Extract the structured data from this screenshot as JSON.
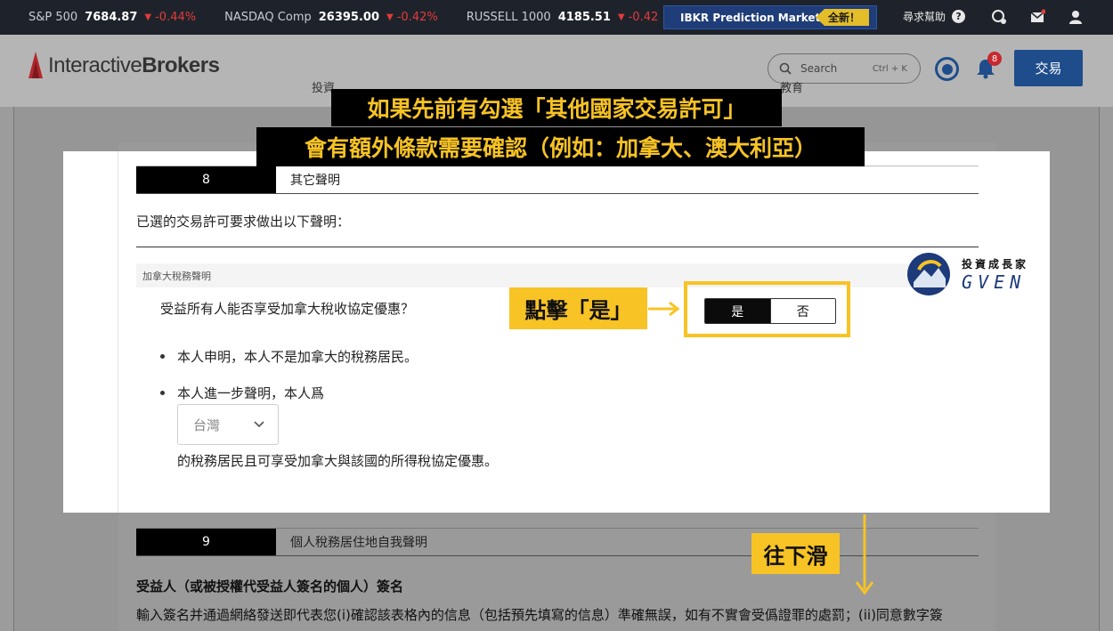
{
  "ticker": [
    {
      "name": "S&P 500",
      "value": "7684.87",
      "change": "-0.44%"
    },
    {
      "name": "NASDAQ Comp",
      "value": "26395.00",
      "change": "-0.42%"
    },
    {
      "name": "RUSSELL 1000",
      "value": "4185.51",
      "change": "-0.42"
    }
  ],
  "ticker_more": "•••",
  "prediction_markets": {
    "label": "IBKR Prediction Markets",
    "badge": "全新！"
  },
  "help_label": "尋求幫助",
  "brand": {
    "logo_text_regular": "Interactive",
    "logo_text_bold": "Brokers"
  },
  "search": {
    "placeholder": "Search",
    "shortcut": "Ctrl + K"
  },
  "notifications_count": "8",
  "trade_button": "交易",
  "nav_fragments": {
    "left": "投資",
    "right": "教育"
  },
  "annotation_banner": {
    "line1": "如果先前有勾選「其他國家交易許可」",
    "line2": "會有額外條款需要確認（例如：加拿大、澳大利亞）"
  },
  "section8": {
    "number": "8",
    "title": "其它聲明",
    "intro": "已選的交易許可要求做出以下聲明：",
    "subheading": "加拿大稅務聲明",
    "question": "受益所有人能否享受加拿大稅收協定優惠？",
    "yes_label": "是",
    "no_label": "否",
    "bullet1": "本人申明，本人不是加拿大的稅務居民。",
    "bullet2": "本人進一步聲明，本人爲",
    "country_select": "台灣",
    "after_select": "的稅務居民且可享受加拿大與該國的所得稅協定優惠。"
  },
  "click_yes_callout": "點擊「是」",
  "scroll_down_callout": "往下滑",
  "section9": {
    "number": "9",
    "title": "個人稅務居住地自我聲明",
    "signature_heading": "受益人（或被授權代受益人簽名的個人）簽名",
    "signature_body": "輸入簽名并通過網絡發送即代表您(i)確認該表格內的信息（包括預先填寫的信息）準確無誤，如有不實會受僞證罪的處罰；(ii)同意數字簽"
  },
  "watermark": {
    "line1": "投資成長家",
    "line2": "GVEN"
  },
  "colors": {
    "accent_yellow": "#f7c325",
    "brand_blue": "#1f4d8c",
    "ticker_bg": "#1e232b",
    "negative_red": "#e23b3b"
  }
}
